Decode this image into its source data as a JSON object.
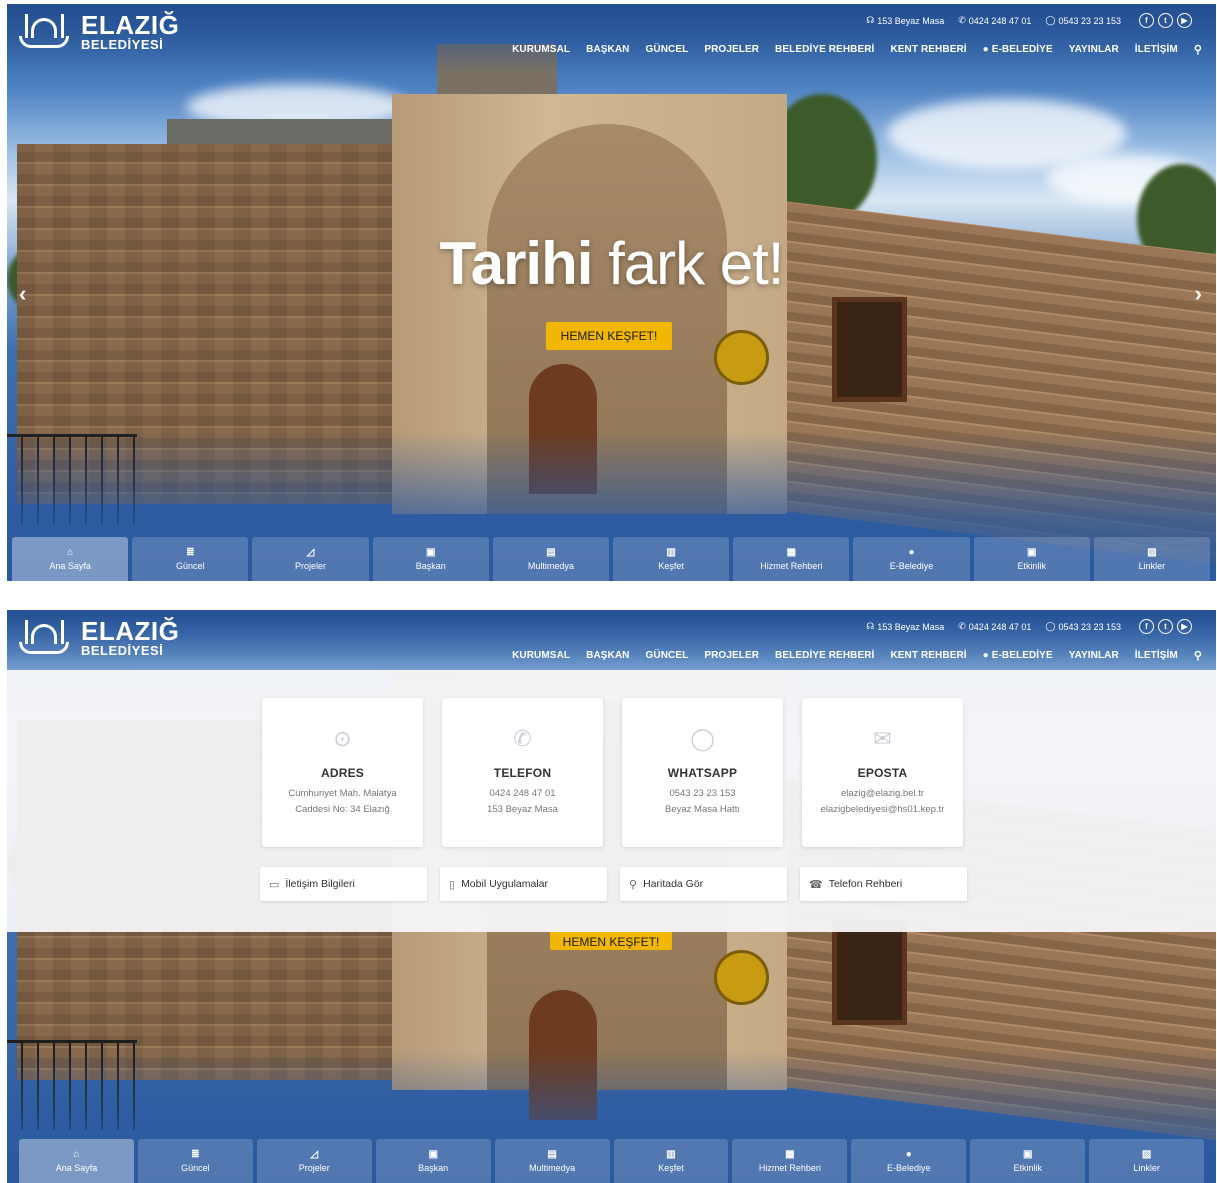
{
  "logo": {
    "name": "ELAZIĞ",
    "sub": "BELEDİYESİ"
  },
  "topbar": {
    "beyaz_masa": "153 Beyaz Masa",
    "phone": "0424 248 47 01",
    "whatsapp": "0543 23 23 153",
    "social": [
      {
        "icon": "facebook-icon",
        "glyph": "f"
      },
      {
        "icon": "twitter-icon",
        "glyph": "t"
      },
      {
        "icon": "youtube-icon",
        "glyph": "▶"
      }
    ]
  },
  "nav": {
    "items": [
      "KURUMSAL",
      "BAŞKAN",
      "GÜNCEL",
      "PROJELER",
      "BELEDİYE REHBERİ",
      "KENT REHBERİ",
      "E-BELEDİYE",
      "YAYINLAR",
      "İLETİŞİM"
    ],
    "search_icon": "search-icon"
  },
  "hero": {
    "title_bold": "Tarihi",
    "title_light": "fark et!",
    "cta": "HEMEN KEŞFET!"
  },
  "tiles": [
    {
      "label": "Ana Sayfa",
      "icon": "home-icon",
      "glyph": "⌂"
    },
    {
      "label": "Güncel",
      "icon": "news-icon",
      "glyph": "≣"
    },
    {
      "label": "Projeler",
      "icon": "pen-icon",
      "glyph": "◿"
    },
    {
      "label": "Başkan",
      "icon": "profile-icon",
      "glyph": "▣"
    },
    {
      "label": "Multimedya",
      "icon": "media-icon",
      "glyph": "▤"
    },
    {
      "label": "Keşfet",
      "icon": "map-icon",
      "glyph": "▥"
    },
    {
      "label": "Hizmet Rehberi",
      "icon": "book-icon",
      "glyph": "▦"
    },
    {
      "label": "E-Belediye",
      "icon": "check-badge-icon",
      "glyph": "●"
    },
    {
      "label": "Etkinlik",
      "icon": "calendar-icon",
      "glyph": "▣"
    },
    {
      "label": "Linkler",
      "icon": "link-icon",
      "glyph": "▨"
    }
  ],
  "contact": {
    "cards": [
      {
        "title": "ADRES",
        "line1": "Cumhuriyet Mah. Malatya",
        "line2": "Caddesi No: 34 Elazığ",
        "icon": "location-pin-icon",
        "glyph": "⊙"
      },
      {
        "title": "TELEFON",
        "line1": "0424 248 47 01",
        "line2": "153 Beyaz Masa",
        "icon": "phone-icon",
        "glyph": "✆"
      },
      {
        "title": "WHATSAPP",
        "line1": "0543 23 23 153",
        "line2": "Beyaz Masa Hattı",
        "icon": "whatsapp-icon",
        "glyph": "◯"
      },
      {
        "title": "EPOSTA",
        "line1": "elazig@elazig.bel.tr",
        "line2": "elazigbelediyesi@hs01.kep.tr",
        "icon": "mail-icon",
        "glyph": "✉"
      }
    ],
    "links": [
      {
        "label": "İletişim Bilgileri",
        "icon": "contact-card-icon",
        "glyph": "▭"
      },
      {
        "label": "Mobil Uygulamalar",
        "icon": "mobile-icon",
        "glyph": "▯"
      },
      {
        "label": "Haritada Gör",
        "icon": "map-pin-icon",
        "glyph": "⚲"
      },
      {
        "label": "Telefon Rehberi",
        "icon": "telephone-icon",
        "glyph": "☎"
      }
    ]
  }
}
